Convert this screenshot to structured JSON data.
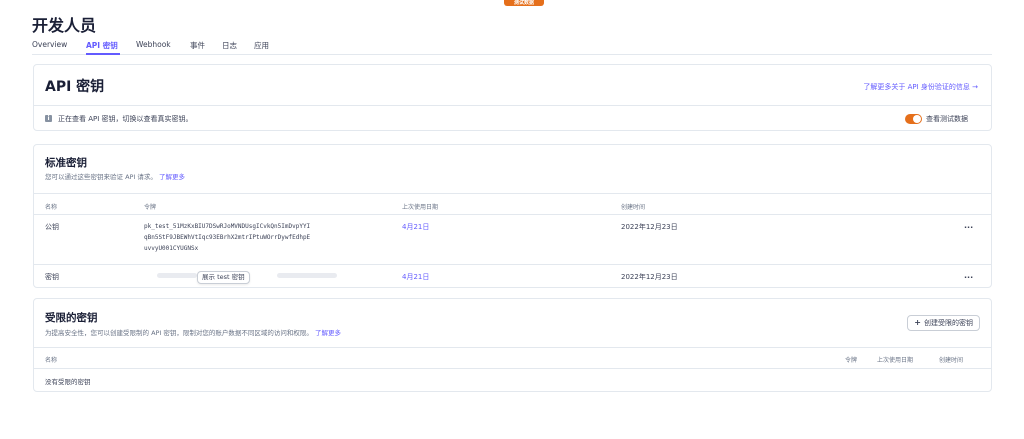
{
  "badge": "测试数据",
  "page_title": "开发人员",
  "tabs": [
    {
      "label": "Overview"
    },
    {
      "label": "API 密钥"
    },
    {
      "label": "Webhook"
    },
    {
      "label": "事件"
    },
    {
      "label": "日志"
    },
    {
      "label": "应用"
    }
  ],
  "api_card": {
    "heading": "API 密钥",
    "learn_link": "了解更多关于 API 身份验证的信息 →",
    "notice": "正在查看 API 密钥，切换以查看真实密钥。",
    "toggle_label": "查看测试数据",
    "toggle_on": true
  },
  "standard": {
    "title": "标准密钥",
    "subtitle": "您可以通过这些密钥来验证 API 请求。",
    "subtitle_link": "了解更多",
    "columns": [
      "名称",
      "令牌",
      "上次使用日期",
      "创建时间"
    ],
    "rows": [
      {
        "name": "公钥",
        "token_lines": [
          "pk_test_51MzKxBIU7DSwRJoMVNDUsgICvkQn5ImDvpYYI",
          "qBn5StF9JBEWhVtIqc93EBrhX2mtrIPtuWOrrDywfEdhpE",
          "uvvyU001CYUGNSx"
        ],
        "last_used": "4月21日",
        "created": "2022年12月23日",
        "menu": "..."
      },
      {
        "name": "密钥",
        "reveal_label": "展示 test 密钥",
        "last_used": "4月21日",
        "created": "2022年12月23日",
        "menu": "..."
      }
    ]
  },
  "restricted": {
    "title": "受限的密钥",
    "subtitle": "为提高安全性，您可以创建受限制的 API 密钥，限制对您的账户数据不同区域的访问和权限。",
    "subtitle_link": "了解更多",
    "create_button": "创建受限的密钥",
    "columns": [
      "名称",
      "令牌",
      "上次使用日期",
      "创建时间"
    ],
    "empty_text": "没有受限的密钥"
  },
  "colors": {
    "accent": "#635bff",
    "toggle": "#e56f1b",
    "border": "#e3e8ee"
  }
}
